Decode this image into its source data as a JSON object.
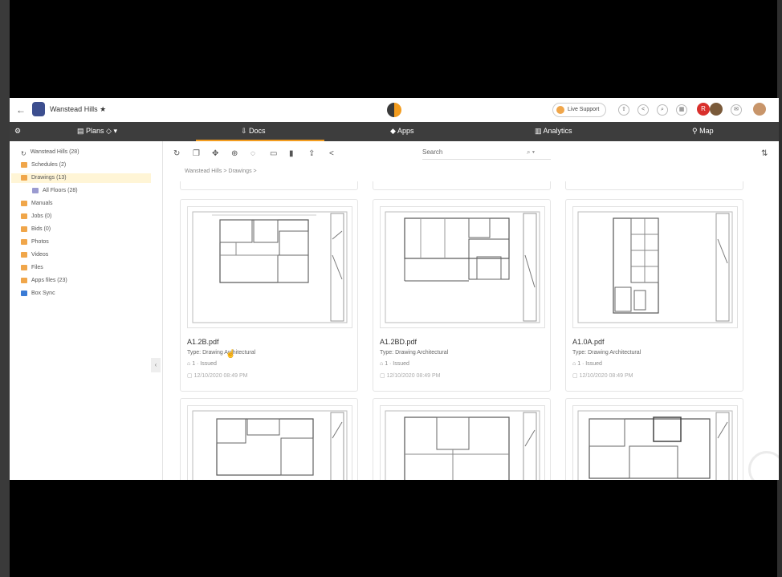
{
  "project": {
    "name": "Wanstead Hills ★"
  },
  "support": {
    "label": "Live Support"
  },
  "avatar_initial": "R",
  "nav": {
    "plans": "Plans ◇ ▾",
    "docs": "Docs",
    "apps": "Apps",
    "analytics": "Analytics",
    "map": "Map"
  },
  "sidebar": {
    "items": [
      {
        "label": "Wanstead Hills (28)",
        "color": "#888888"
      },
      {
        "label": "Schedules (2)",
        "color": "#f0a64a"
      },
      {
        "label": "Drawings (13)",
        "color": "#f0a64a"
      },
      {
        "label": "All Floors (28)",
        "color": "#9b9bd0"
      },
      {
        "label": "Manuals",
        "color": "#f0a64a"
      },
      {
        "label": "Jobs (0)",
        "color": "#f0a64a"
      },
      {
        "label": "Bids (0)",
        "color": "#f0a64a"
      },
      {
        "label": "Photos",
        "color": "#f0a64a"
      },
      {
        "label": "Videos",
        "color": "#f0a64a"
      },
      {
        "label": "Files",
        "color": "#f0a64a"
      },
      {
        "label": "Apps files (23)",
        "color": "#f0a64a"
      },
      {
        "label": "Box Sync",
        "color": "#3a7bd5"
      }
    ]
  },
  "search": {
    "placeholder": "Search"
  },
  "breadcrumb": "Wanstead Hills  >  Drawings  >",
  "cards": [
    {
      "name": "A1.2B.pdf",
      "type": "Type: Drawing Architectural",
      "meta1": "1 · Issued",
      "meta2": "12/10/2020 08:49 PM"
    },
    {
      "name": "A1.2BD.pdf",
      "type": "Type: Drawing Architectural",
      "meta1": "1 · Issued",
      "meta2": "12/10/2020 08:49 PM"
    },
    {
      "name": "A1.0A.pdf",
      "type": "Type: Drawing Architectural",
      "meta1": "1 · Issued",
      "meta2": "12/10/2020 08:49 PM"
    }
  ],
  "colors": {
    "accent": "#f39c1e",
    "navbar": "#3d3d3d",
    "selected": "#fff5d6"
  }
}
